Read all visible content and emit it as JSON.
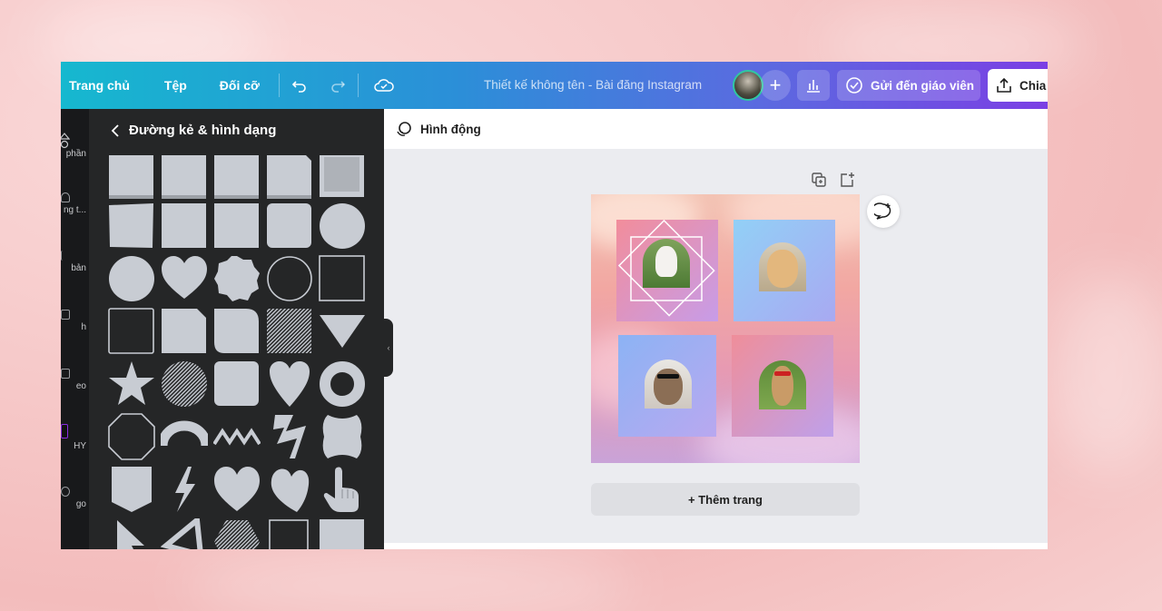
{
  "topbar": {
    "home": "Trang chủ",
    "file": "Tệp",
    "resize": "Đối cỡ",
    "doc_title": "Thiết kế không tên - Bài đăng Instagram",
    "send_label": "Gửi đến giáo viên",
    "share_label": "Chia",
    "icons": [
      "undo-icon",
      "redo-icon",
      "cloud-saved-icon",
      "plus-icon",
      "bar-chart-icon",
      "check-circle-icon",
      "share-upload-icon"
    ]
  },
  "rail": {
    "items": [
      {
        "label": "phần",
        "icon": "elements-icon"
      },
      {
        "label": "ng t...",
        "icon": "upload-icon"
      },
      {
        "label": "bản",
        "icon": "text-icon"
      },
      {
        "label": "h",
        "icon": "photo-icon"
      },
      {
        "label": "eo",
        "icon": "video-icon"
      },
      {
        "label": "HY",
        "icon": "giphy-icon"
      },
      {
        "label": "go",
        "icon": "logo-icon"
      }
    ]
  },
  "panel": {
    "title": "Đường kẻ & hình dạng",
    "back_icon": "chevron-left-icon"
  },
  "editor": {
    "animate_label": "Hình động",
    "add_page_label": "+ Thêm trang",
    "colors": {
      "accent_start": "#16b8cf",
      "accent_end": "#7b3fe4",
      "shape_fill": "#c8ccd3"
    }
  }
}
